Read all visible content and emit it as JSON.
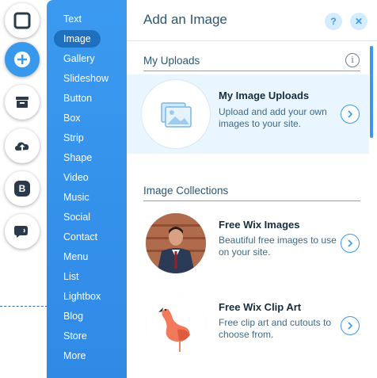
{
  "rail": {
    "items": [
      {
        "icon": "square-icon"
      },
      {
        "icon": "plus-icon",
        "active": true
      },
      {
        "icon": "store-icon"
      },
      {
        "icon": "upload-cloud-icon"
      },
      {
        "icon": "blog-b-icon",
        "glyph": "B"
      },
      {
        "icon": "chat-bubble-icon"
      }
    ]
  },
  "menu": {
    "items": [
      {
        "label": "Text"
      },
      {
        "label": "Image",
        "selected": true
      },
      {
        "label": "Gallery"
      },
      {
        "label": "Slideshow"
      },
      {
        "label": "Button"
      },
      {
        "label": "Box"
      },
      {
        "label": "Strip"
      },
      {
        "label": "Shape"
      },
      {
        "label": "Video"
      },
      {
        "label": "Music"
      },
      {
        "label": "Social"
      },
      {
        "label": "Contact"
      },
      {
        "label": "Menu"
      },
      {
        "label": "List"
      },
      {
        "label": "Lightbox"
      },
      {
        "label": "Blog"
      },
      {
        "label": "Store"
      },
      {
        "label": "More"
      }
    ]
  },
  "panel": {
    "title": "Add an Image",
    "help_label": "?",
    "close_label": "✕",
    "uploads_section": {
      "title": "My Uploads",
      "info_label": "i",
      "card": {
        "title": "My Image Uploads",
        "description": "Upload and add your own images to your site."
      }
    },
    "collections_section": {
      "title": "Image Collections",
      "cards": [
        {
          "title": "Free Wix Images",
          "description": "Beautiful free images to use on your site."
        },
        {
          "title": "Free Wix Clip Art",
          "description": "Free clip art and cutouts to choose from."
        }
      ]
    }
  },
  "colors": {
    "menu_blue": "#3b9af0",
    "menu_selected": "#1f6fbf",
    "accent": "#3899ec",
    "title_text": "#2b5672",
    "highlight_bg": "#eaf6ff"
  }
}
